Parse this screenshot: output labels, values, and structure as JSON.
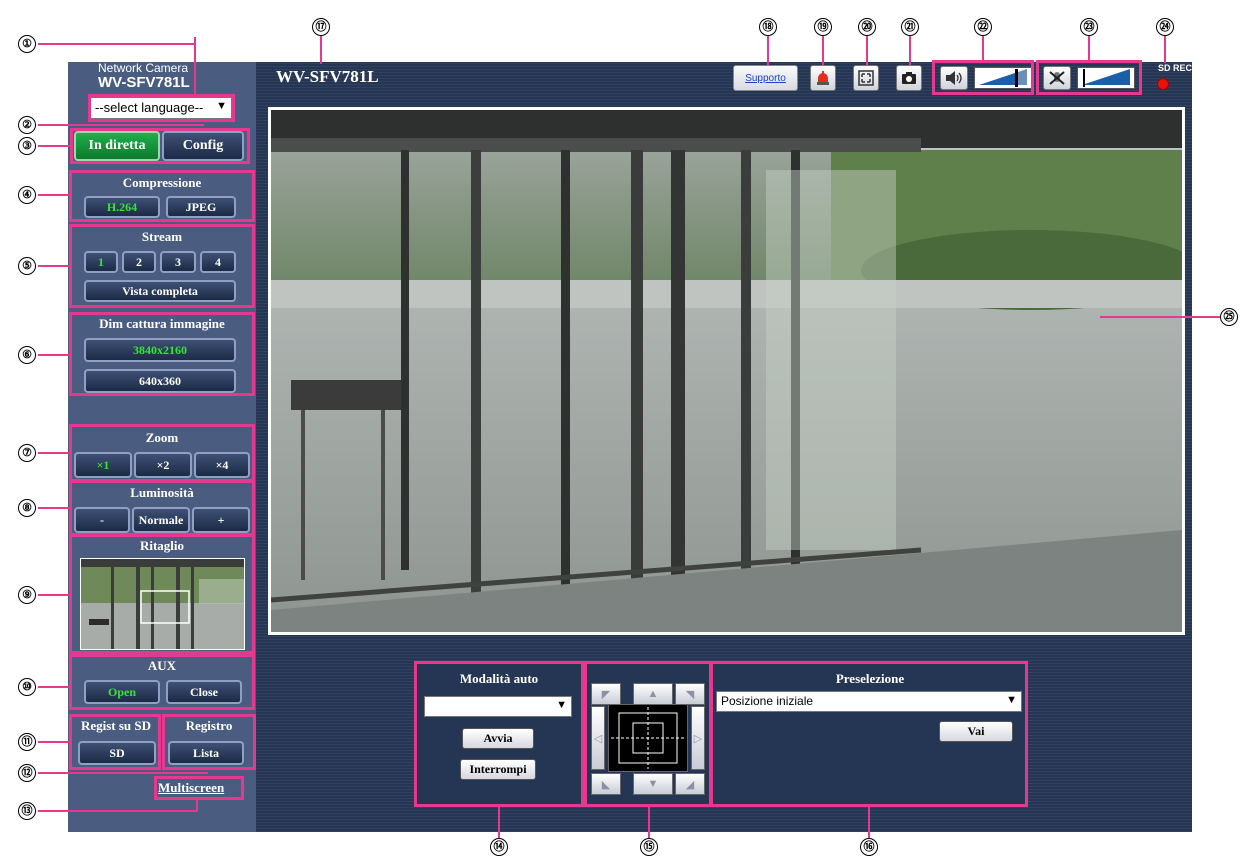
{
  "brand": {
    "line1": "Network Camera",
    "line2": "WV-SFV781L"
  },
  "camera_title": "WV-SFV781L",
  "language": {
    "selected": "--select language--"
  },
  "nav": {
    "live": "In diretta",
    "config": "Config"
  },
  "compression": {
    "title": "Compressione",
    "h264": "H.264",
    "jpeg": "JPEG",
    "active": "H.264"
  },
  "stream": {
    "title": "Stream",
    "items": [
      "1",
      "2",
      "3",
      "4"
    ],
    "active": "1",
    "full_view": "Vista completa"
  },
  "capture": {
    "title": "Dim cattura immagine",
    "sizes": [
      "3840x2160",
      "640x360"
    ],
    "active": "3840x2160"
  },
  "zoom": {
    "title": "Zoom",
    "items": [
      "×1",
      "×2",
      "×4"
    ],
    "active": "×1"
  },
  "brightness": {
    "title": "Luminosità",
    "minus": "-",
    "normal": "Normale",
    "plus": "+"
  },
  "crop": {
    "title": "Ritaglio"
  },
  "aux": {
    "title": "AUX",
    "open": "Open",
    "close": "Close"
  },
  "sd": {
    "title": "Regist su SD",
    "button": "SD"
  },
  "log": {
    "title": "Registro",
    "button": "Lista"
  },
  "multiscreen": "Multiscreen",
  "toolbar": {
    "support": "Supporto",
    "sd_rec": "SD REC"
  },
  "auto_mode": {
    "title": "Modalità auto",
    "value": "",
    "start": "Avvia",
    "stop": "Interrompi"
  },
  "preset": {
    "title": "Preselezione",
    "value": "Posizione iniziale",
    "go": "Vai"
  },
  "callouts": [
    "①",
    "②",
    "③",
    "④",
    "⑤",
    "⑥",
    "⑦",
    "⑧",
    "⑨",
    "⑩",
    "⑪",
    "⑫",
    "⑬",
    "⑭",
    "⑮",
    "⑯",
    "⑰",
    "⑱",
    "⑲",
    "⑳",
    "㉑",
    "㉒",
    "㉓",
    "㉔",
    "㉕"
  ],
  "colors": {
    "sidebar": "#4a5d80",
    "main": "#253554",
    "highlight": "#e6388f",
    "active_text": "#35e635",
    "live_button": "#1fae4a"
  },
  "icons": [
    "alarm-icon",
    "fullscreen-icon",
    "camera-icon",
    "speaker-icon",
    "mic-mute-icon",
    "sd-rec-indicator-icon"
  ]
}
